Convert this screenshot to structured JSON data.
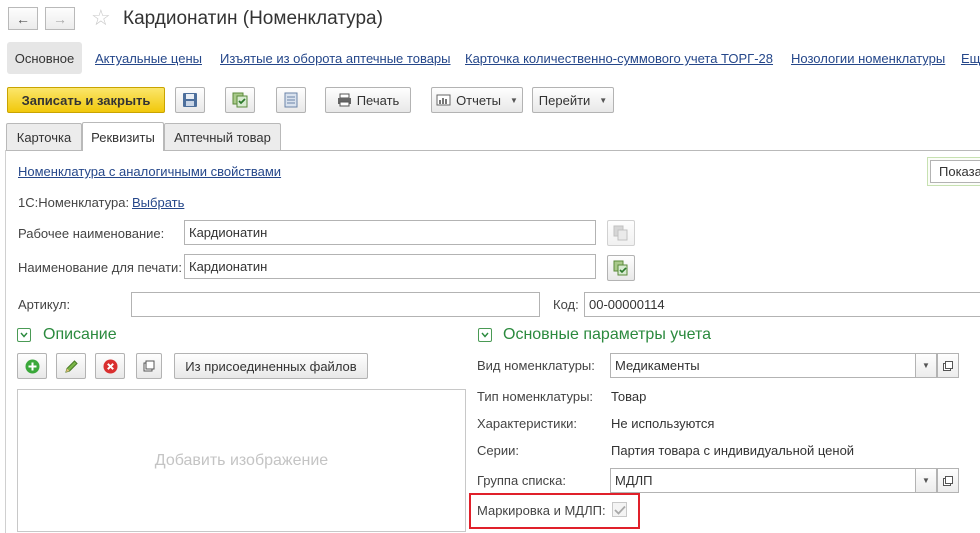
{
  "window": {
    "title": "Кардионатин (Номенклатура)"
  },
  "sections": {
    "active": "Основное",
    "links": [
      "Актуальные цены",
      "Изъятые из оборота аптечные товары",
      "Карточка количественно-суммового учета ТОРГ-28",
      "Нозологии номенклатуры",
      "Ещ"
    ]
  },
  "toolbar": {
    "save_close": "Записать и закрыть",
    "print": "Печать",
    "reports": "Отчеты",
    "goto": "Перейти"
  },
  "tabs": {
    "card": "Карточка",
    "requisites": "Реквизиты",
    "pharmacy": "Аптечный товар",
    "active": "Реквизиты"
  },
  "form": {
    "similar_link": "Номенклатура с аналогичными свойствами",
    "show_button": "Показа",
    "onec_label": "1С:Номенклатура:",
    "onec_select": "Выбрать",
    "work_name_label": "Рабочее наименование:",
    "work_name_value": "Кардионатин",
    "print_name_label": "Наименование для печати:",
    "print_name_value": "Кардионатин",
    "article_label": "Артикул:",
    "article_value": "",
    "code_label": "Код:",
    "code_value": "00-00000114"
  },
  "description": {
    "header": "Описание",
    "from_files": "Из присоединенных файлов",
    "add_image": "Добавить изображение"
  },
  "accounting": {
    "header": "Основные параметры учета",
    "kind_label": "Вид номенклатуры:",
    "kind_value": "Медикаменты",
    "type_label": "Тип номенклатуры:",
    "type_value": "Товар",
    "chars_label": "Характеристики:",
    "chars_value": "Не используются",
    "series_label": "Серии:",
    "series_value": "Партия товара с индивидуальной ценой",
    "group_label": "Группа списка:",
    "group_value": "МДЛП",
    "marking_label": "Маркировка и МДЛП:",
    "marking_checked": true
  },
  "colors": {
    "accent_yellow": "#f5d41f",
    "link_blue": "#25478a",
    "group_green": "#2b8a3e",
    "highlight_red": "#e0202a"
  }
}
